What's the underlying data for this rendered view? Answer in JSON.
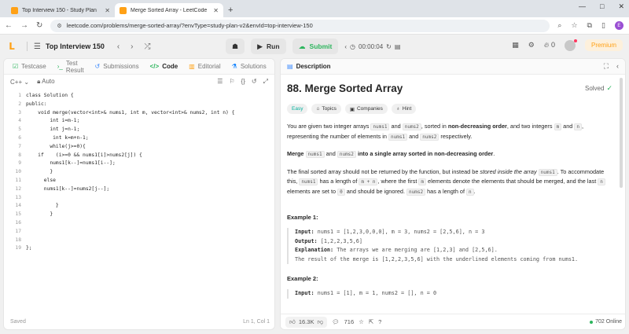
{
  "browser": {
    "tabs": [
      {
        "title": "Top Interview 150 - Study Plan",
        "active": false
      },
      {
        "title": "Merge Sorted Array - LeetCode",
        "active": true
      }
    ],
    "new_tab": "+",
    "url": "leetcode.com/problems/merge-sorted-array/?envType=study-plan-v2&envId=top-interview-150",
    "profile_initial": "E"
  },
  "header": {
    "plan_title": "Top Interview 150",
    "run_label": "Run",
    "submit_label": "Submit",
    "timer": "00:00:04",
    "streak": "0",
    "premium_label": "Premium"
  },
  "editor": {
    "tabs": [
      {
        "label": "Testcase",
        "icon": "check-square-icon"
      },
      {
        "label": "Test Result",
        "icon": "terminal-icon"
      },
      {
        "label": "Submissions",
        "icon": "history-icon"
      },
      {
        "label": "Code",
        "icon": "code-icon"
      },
      {
        "label": "Editorial",
        "icon": "book-icon"
      },
      {
        "label": "Solutions",
        "icon": "flask-icon"
      }
    ],
    "language": "C++",
    "mode": "Auto",
    "code_lines": [
      "class Solution {",
      "public:",
      "    void merge(vector<int>& nums1, int m, vector<int>& nums2, int n) {",
      "        int i=m-1;",
      "        int j=n-1;",
      "         int k=m+n-1;",
      "        while(j>=0){",
      "    if    (i>=0 && nums1[i]>nums2[j]) {",
      "        nums1[k--]=nums1[i--];",
      "        }",
      "      else",
      "      nums1[k--]=nums2[j--];",
      "",
      "          }",
      "        }",
      "",
      "",
      "",
      "};"
    ],
    "status": "Saved",
    "cursor": "Ln 1, Col 1"
  },
  "description": {
    "tab_label": "Description",
    "title": "88. Merge Sorted Array",
    "solved_label": "Solved",
    "chips": [
      "Easy",
      "Topics",
      "Companies",
      "Hint"
    ],
    "p1": {
      "a": "You are given two integer arrays ",
      "c1": "nums1",
      "b": " and ",
      "c2": "nums2",
      "c": ", sorted in ",
      "bold": "non-decreasing order",
      "d": ", and two integers ",
      "c3": "m",
      "e": " and ",
      "c4": "n",
      "f": ", representing the number of elements in ",
      "c5": "nums1",
      "g": " and ",
      "c6": "nums2",
      "h": " respectively."
    },
    "p2": {
      "bold1": "Merge",
      "c1": "nums1",
      "b1": "and",
      "c2": "nums2",
      "bold2": "into a single array sorted in non-decreasing order",
      "end": "."
    },
    "p3": {
      "a": "The final sorted array should not be returned by the function, but instead be ",
      "it": "stored inside the array",
      "c1": "nums1",
      "b": ". To accommodate this, ",
      "c2": "nums1",
      "c": " has a length of ",
      "c3": "m + n",
      "d": ", where the first ",
      "c4": "m",
      "e": " elements denote the elements that should be merged, and the last ",
      "c5": "n",
      "f": " elements are set to ",
      "c6": "0",
      "g": " and should be ignored. ",
      "c7": "nums2",
      "h": " has a length of ",
      "c8": "n",
      "i": "."
    },
    "examples": [
      {
        "heading": "Example 1:",
        "input_label": "Input:",
        "input": "nums1 = [1,2,3,0,0,0], m = 3, nums2 = [2,5,6], n = 3",
        "output_label": "Output:",
        "output": "[1,2,2,3,5,6]",
        "expl_label": "Explanation:",
        "expl": "The arrays we are merging are [1,2,3] and [2,5,6].",
        "expl2": "The result of the merge is [1,2,2,3,5,6] with the underlined elements coming from nums1."
      },
      {
        "heading": "Example 2:",
        "input_label": "Input:",
        "input": "nums1 = [1], m = 1, nums2 = [], n = 0"
      }
    ],
    "footer": {
      "likes": "16.3K",
      "comments": "716",
      "online": "702 Online"
    }
  },
  "colors": {
    "accent": "#ffa116",
    "submit": "#2db55d",
    "easy": "#00af9b"
  }
}
